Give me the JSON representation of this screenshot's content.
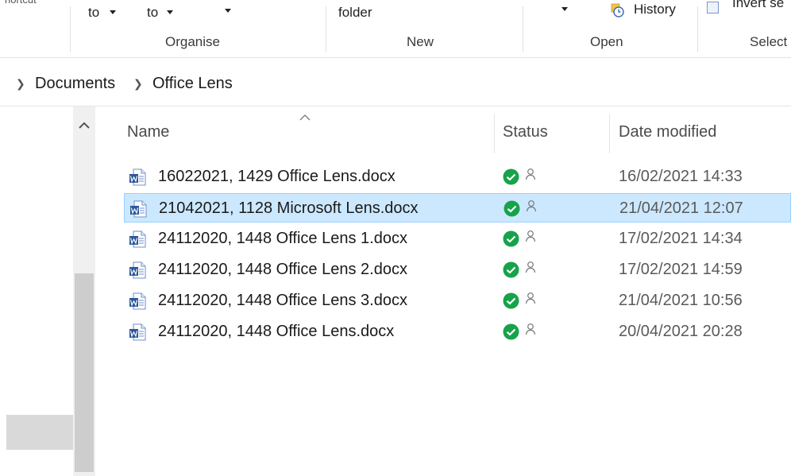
{
  "ribbon": {
    "clipboard_fragment": "hortcut",
    "move_to_label": "to",
    "copy_to_label": "to",
    "new_folder_label": "folder",
    "history_label": "History",
    "invert_label": "Invert se",
    "groups": {
      "organise": "Organise",
      "new": "New",
      "open": "Open",
      "select": "Select"
    }
  },
  "address": {
    "crumbs": [
      "Documents",
      "Office Lens"
    ]
  },
  "columns": {
    "name": "Name",
    "status": "Status",
    "date_modified": "Date modified"
  },
  "files": [
    {
      "name": "16022021, 1429 Office Lens.docx",
      "date": "16/02/2021 14:33",
      "selected": false
    },
    {
      "name": "21042021, 1128 Microsoft Lens.docx",
      "date": "21/04/2021 12:07",
      "selected": true
    },
    {
      "name": "24112020, 1448 Office Lens 1.docx",
      "date": "17/02/2021 14:34",
      "selected": false
    },
    {
      "name": "24112020, 1448 Office Lens 2.docx",
      "date": "17/02/2021 14:59",
      "selected": false
    },
    {
      "name": "24112020, 1448 Office Lens 3.docx",
      "date": "21/04/2021 10:56",
      "selected": false
    },
    {
      "name": "24112020, 1448 Office Lens.docx",
      "date": "20/04/2021 20:28",
      "selected": false
    }
  ],
  "icons": {
    "file": "word-document-icon",
    "status": "sync-ok-check-icon",
    "availability": "person-icon"
  },
  "colors": {
    "selection": "#cce8ff",
    "selection_border": "#99d1ff",
    "status_green": "#16a34a",
    "word_blue": "#2b579a"
  }
}
